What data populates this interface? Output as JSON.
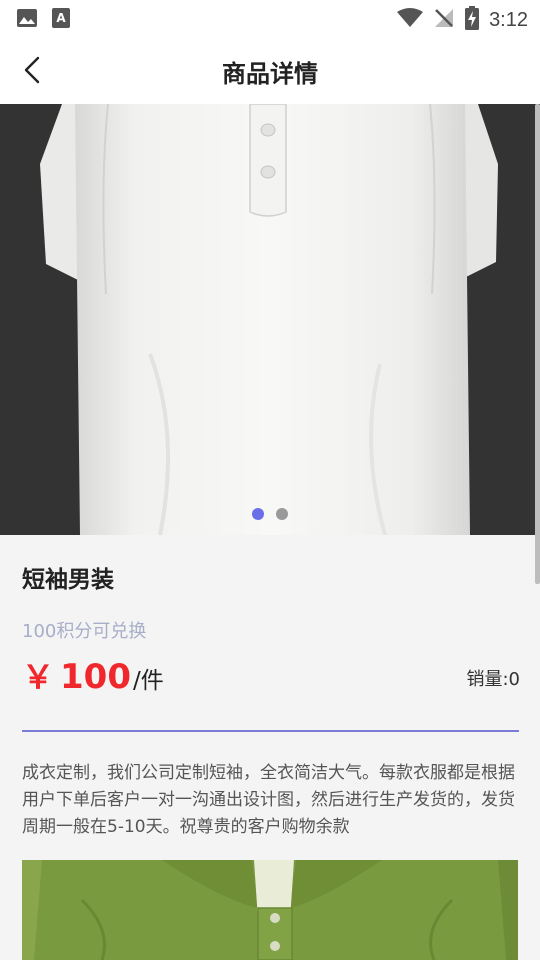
{
  "status_bar": {
    "time": "3:12",
    "icons": [
      "image-icon",
      "text-a-icon",
      "wifi-icon",
      "no-signal-icon",
      "battery-charging-icon"
    ]
  },
  "nav": {
    "title": "商品详情",
    "back_icon": "chevron-left-icon"
  },
  "carousel": {
    "image": "white-polo-shirt",
    "slide_count": 2,
    "active_index": 0,
    "active_color": "#6a6ee8",
    "inactive_color": "#9a9a9a"
  },
  "product": {
    "name": "短袖男装",
    "points_note": "100积分可兑换",
    "price_symbol": "￥",
    "price": "100",
    "unit": "/件",
    "sales": "销量:0",
    "description": "成衣定制，我们公司定制短袖，全衣简洁大气。每款衣服都是根据用户下单后客户一对一沟通出设计图，然后进行生产发货的，发货周期一般在5-10天。祝尊贵的客户购物余款",
    "detail_image": "green-polo-shirt"
  },
  "colors": {
    "price": "#f0282d",
    "points": "#a8aec8",
    "divider": "#7a7cd6"
  }
}
